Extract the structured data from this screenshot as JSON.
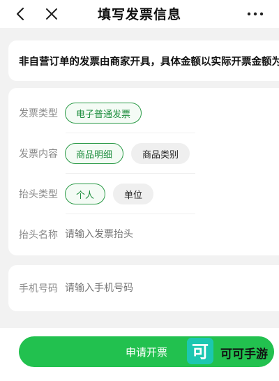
{
  "nav": {
    "title": "填写发票信息",
    "back_icon": "chevron-left-icon",
    "close_icon": "close-icon",
    "more_icon": "more-dots-icon"
  },
  "notice": {
    "text": "非自营订单的发票由商家开具，具体金额以实际开票金额为准"
  },
  "invoice_form": {
    "invoice_type": {
      "label": "发票类型",
      "options": [
        {
          "label": "电子普通发票",
          "selected": true
        }
      ]
    },
    "invoice_content": {
      "label": "发票内容",
      "options": [
        {
          "label": "商品明细",
          "selected": true
        },
        {
          "label": "商品类别",
          "selected": false
        }
      ]
    },
    "title_type": {
      "label": "抬头类型",
      "options": [
        {
          "label": "个人",
          "selected": true
        },
        {
          "label": "单位",
          "selected": false
        }
      ]
    },
    "title_name": {
      "label": "抬头名称",
      "placeholder": "请输入发票抬头",
      "value": ""
    }
  },
  "contact_form": {
    "phone": {
      "label": "手机号码",
      "placeholder": "请输入手机号码",
      "value": ""
    }
  },
  "footer": {
    "submit_label": "申请开票"
  },
  "watermark": {
    "logo_glyph": "可",
    "text": "可可手游"
  },
  "colors": {
    "accent": "#22c14f",
    "selected_border": "#2a9a46",
    "selected_text": "#1e8e3e",
    "label_gray": "#8a8a8a",
    "background": "#f2f2f2"
  }
}
